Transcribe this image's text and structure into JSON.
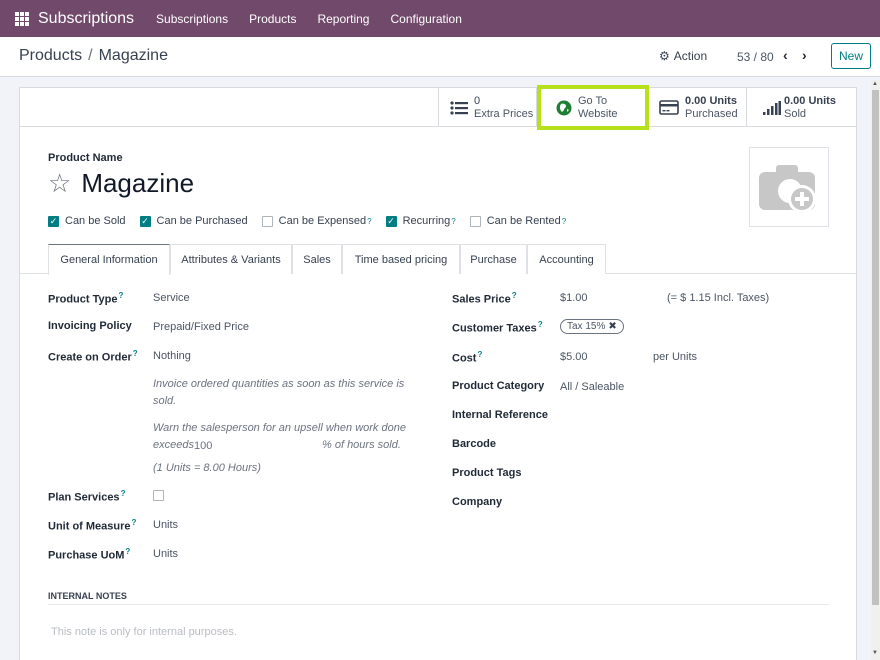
{
  "topbar": {
    "app_name": "Subscriptions",
    "menu": [
      "Subscriptions",
      "Products",
      "Reporting",
      "Configuration"
    ]
  },
  "controlbar": {
    "breadcrumb_parent": "Products",
    "breadcrumb_sep": "/",
    "breadcrumb_current": "Magazine",
    "action_label": "Action",
    "pager": "53 / 80",
    "new_label": "New"
  },
  "buttonbox": {
    "extra_prices": {
      "value": "0",
      "label": "Extra Prices"
    },
    "website": {
      "line1": "Go To",
      "line2": "Website"
    },
    "purchased": {
      "value": "0.00 Units",
      "label": "Purchased"
    },
    "sold": {
      "value": "0.00 Units",
      "label": "Sold"
    }
  },
  "product": {
    "name_label": "Product Name",
    "name": "Magazine",
    "options": [
      {
        "label": "Can be Sold",
        "checked": true,
        "help": false
      },
      {
        "label": "Can be Purchased",
        "checked": true,
        "help": false
      },
      {
        "label": "Can be Expensed",
        "checked": false,
        "help": true
      },
      {
        "label": "Recurring",
        "checked": true,
        "help": true
      },
      {
        "label": "Can be Rented",
        "checked": false,
        "help": true
      }
    ]
  },
  "tabs": [
    "General Information",
    "Attributes & Variants",
    "Sales",
    "Time based pricing",
    "Purchase",
    "Accounting"
  ],
  "active_tab": "General Information",
  "left_fields": {
    "product_type": {
      "label": "Product Type",
      "value": "Service"
    },
    "invoicing_policy": {
      "label": "Invoicing Policy",
      "value": "Prepaid/Fixed Price"
    },
    "create_on_order": {
      "label": "Create on Order",
      "value": "Nothing"
    },
    "help_invoice": "Invoice ordered quantities as soon as this service is sold.",
    "help_upsell_1": "Warn the salesperson for an upsell when work done",
    "help_upsell_exceeds": "exceeds",
    "help_upsell_value": "100",
    "help_upsell_suffix": "% of hours sold.",
    "help_units": "(1 Units = 8.00 Hours)",
    "plan_services": {
      "label": "Plan Services",
      "checked": false
    },
    "uom": {
      "label": "Unit of Measure",
      "value": "Units"
    },
    "purchase_uom": {
      "label": "Purchase UoM",
      "value": "Units"
    }
  },
  "right_fields": {
    "sales_price": {
      "label": "Sales Price",
      "value": "$1.00",
      "incl": "(= $ 1.15 Incl. Taxes)"
    },
    "customer_taxes": {
      "label": "Customer Taxes",
      "tag": "Tax 15%"
    },
    "cost": {
      "label": "Cost",
      "value": "$5.00",
      "per": "per Units"
    },
    "category": {
      "label": "Product Category",
      "value": "All / Saleable"
    },
    "internal_ref": {
      "label": "Internal Reference",
      "value": ""
    },
    "barcode": {
      "label": "Barcode",
      "value": ""
    },
    "tags": {
      "label": "Product Tags",
      "value": ""
    },
    "company": {
      "label": "Company",
      "value": ""
    }
  },
  "notes": {
    "title": "INTERNAL NOTES",
    "placeholder": "This note is only for internal purposes."
  },
  "colors": {
    "topbar": "#71496a",
    "accent": "#017e84",
    "highlight": "#b6e11a"
  }
}
